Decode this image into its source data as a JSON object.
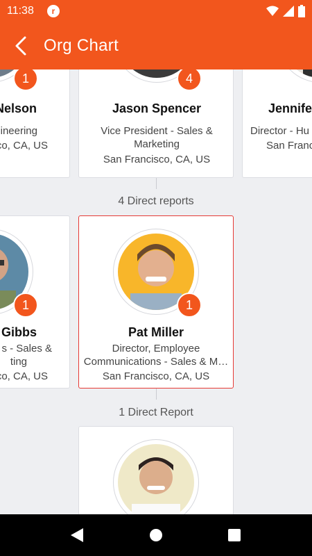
{
  "status_bar": {
    "time": "11:38",
    "app_icon_letter": "r"
  },
  "app_bar": {
    "title": "Org Chart",
    "back_icon": "chevron-left-icon"
  },
  "colors": {
    "accent": "#f2561d",
    "selected_border": "#e53935"
  },
  "row1": {
    "left": {
      "name": "Nelson",
      "role": "ineering",
      "location": "co, CA, US",
      "badge": "1"
    },
    "center": {
      "name": "Jason Spencer",
      "role": "Vice President - Sales & Marketing",
      "location": "San Francisco, CA, US",
      "badge": "4"
    },
    "right": {
      "name": "Jennife",
      "role": "Director - Hu",
      "location": "San Franc"
    }
  },
  "row1_reports_label": "4 Direct reports",
  "row2": {
    "left": {
      "name": "Gibbs",
      "role_line1": "s - Sales &",
      "role_line2": "ting",
      "location": "co, CA, US",
      "badge": "1"
    },
    "center": {
      "name": "Pat Miller",
      "role_line1": "Director, Employee",
      "role_line2": "Communications - Sales & M…",
      "location": "San Francisco, CA, US",
      "badge": "1"
    }
  },
  "row2_reports_label": "1 Direct Report"
}
